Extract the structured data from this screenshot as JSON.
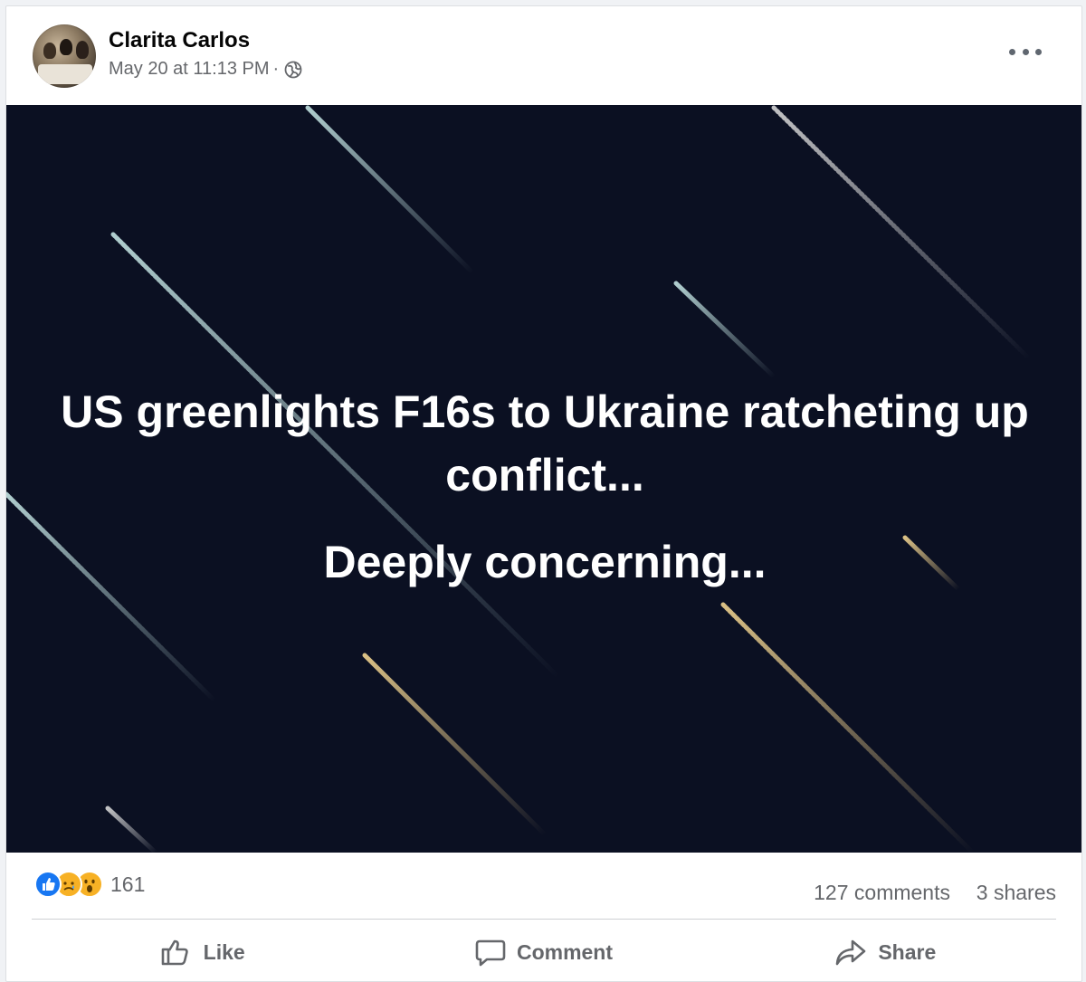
{
  "post": {
    "author": "Clarita Carlos",
    "timestamp": "May 20 at 11:13 PM",
    "separator": "·",
    "audience_icon": "globe-icon",
    "options_icon": "more-options-icon"
  },
  "media": {
    "line1": "US greenlights F16s to Ukraine ratcheting up conflict...",
    "line2": "Deeply concerning...",
    "background_color": "#0b1022"
  },
  "stats": {
    "reactions": [
      "like",
      "sad",
      "wow"
    ],
    "reaction_count": "161",
    "comments": "127 comments",
    "shares": "3 shares"
  },
  "actions": {
    "like": "Like",
    "comment": "Comment",
    "share": "Share"
  },
  "colors": {
    "like_blue": "#1877f2",
    "secondary_text": "#65676b"
  }
}
